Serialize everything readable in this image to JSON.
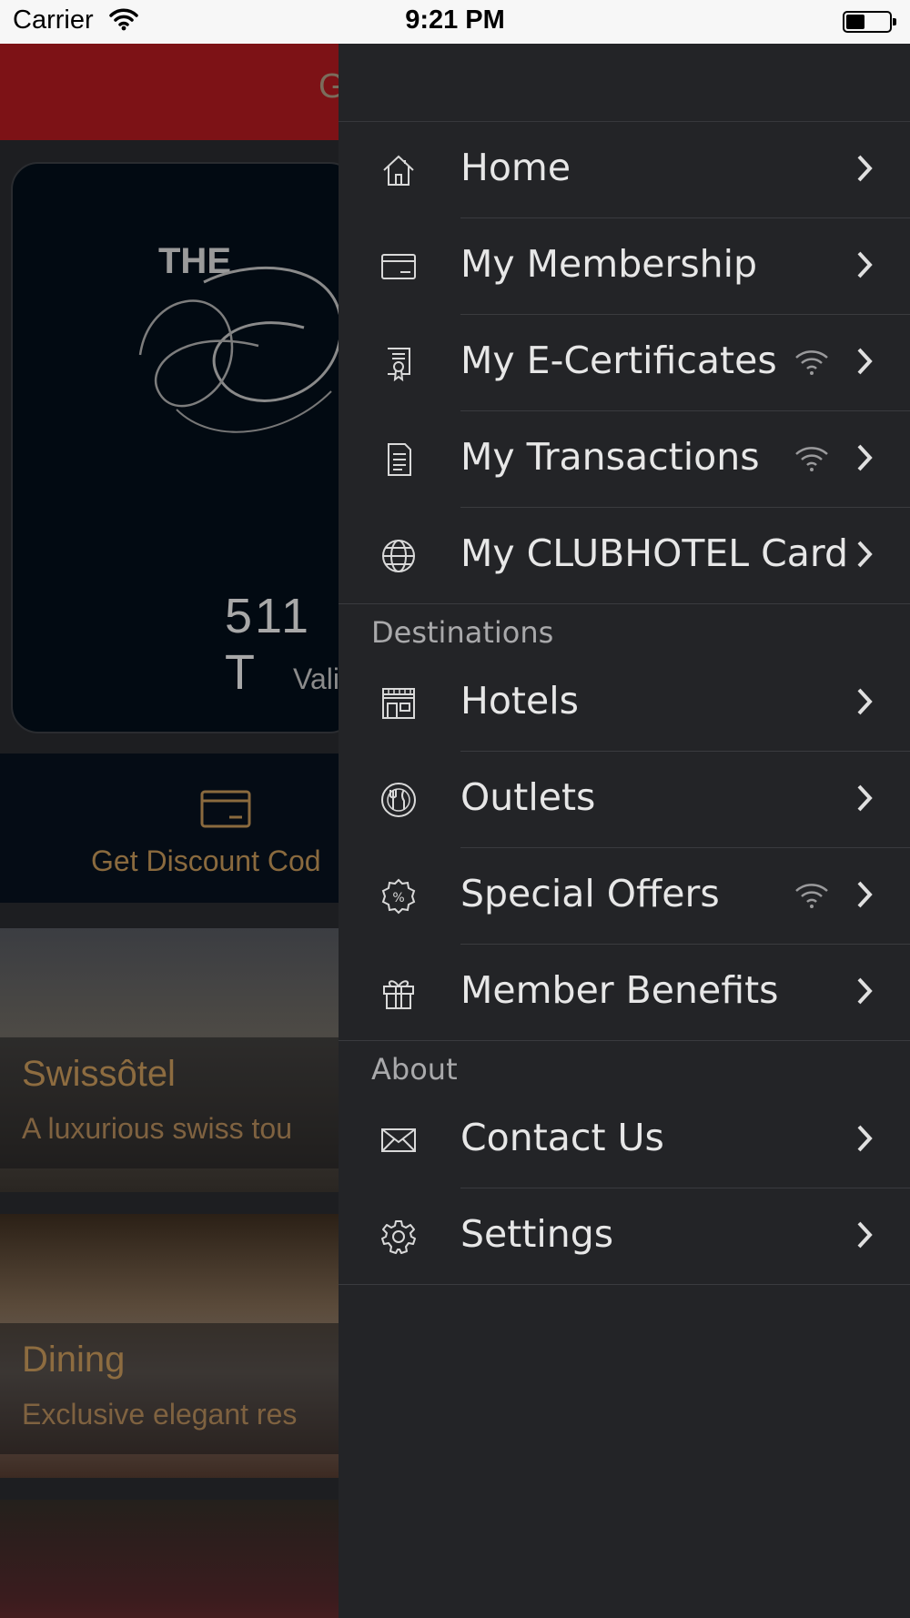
{
  "status_bar": {
    "carrier": "Carrier",
    "time": "9:21 PM",
    "battery_level": 0.4
  },
  "background_app": {
    "header_title_partial": "G",
    "card": {
      "logo_text": "THE",
      "number_partial": "511 T",
      "valid_partial": "Vali"
    },
    "discount_label_partial": "Get Discount Cod",
    "promos": [
      {
        "title": "Swissôtel",
        "subtitle_partial": "A luxurious swiss tou"
      },
      {
        "title": "Dining",
        "subtitle_partial": "Exclusive elegant res"
      }
    ]
  },
  "menu": {
    "items": [
      {
        "label": "Home",
        "icon": "home-icon",
        "wifi": false
      },
      {
        "label": "My Membership",
        "icon": "card-icon",
        "wifi": false
      },
      {
        "label": "My E-Certificates",
        "icon": "certificate-icon",
        "wifi": true
      },
      {
        "label": "My Transactions",
        "icon": "receipt-icon",
        "wifi": true
      },
      {
        "label": "My CLUBHOTEL Card",
        "icon": "globe-icon",
        "wifi": false
      }
    ],
    "destinations_header": "Destinations",
    "destinations": [
      {
        "label": "Hotels",
        "icon": "hotel-icon",
        "wifi": false
      },
      {
        "label": "Outlets",
        "icon": "dining-icon",
        "wifi": false
      },
      {
        "label": "Special Offers",
        "icon": "discount-badge-icon",
        "wifi": true
      },
      {
        "label": "Member Benefits",
        "icon": "gift-icon",
        "wifi": false
      }
    ],
    "about_header": "About",
    "about": [
      {
        "label": "Contact Us",
        "icon": "envelope-icon",
        "wifi": false
      },
      {
        "label": "Settings",
        "icon": "gear-icon",
        "wifi": false
      }
    ]
  },
  "colors": {
    "drawer_bg": "#232427",
    "header_red": "#b71c23",
    "accent_gold": "#c49455"
  }
}
